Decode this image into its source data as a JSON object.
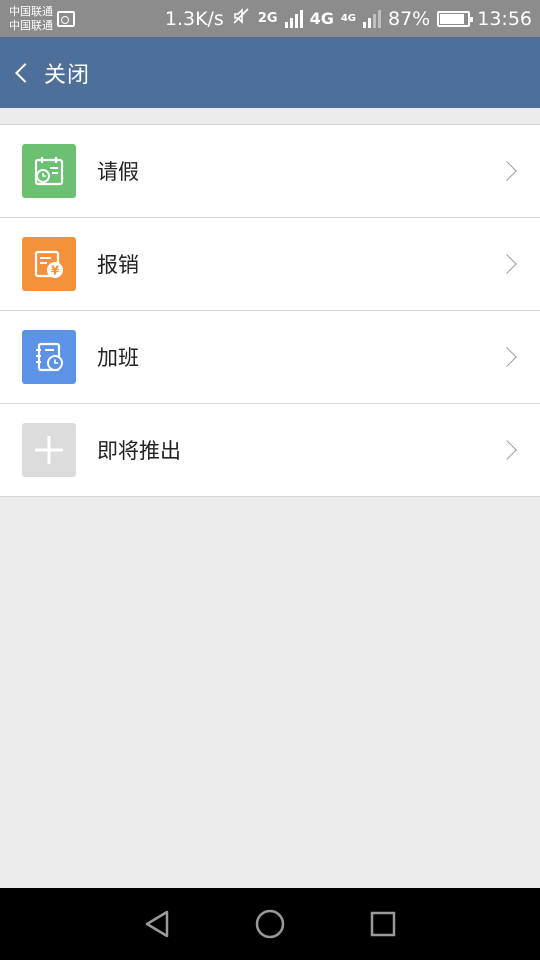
{
  "status_bar": {
    "carrier_1": "中国联通",
    "carrier_2": "中国联通",
    "net_speed": "1.3K/s",
    "net_2g": "2G",
    "net_4g": "4G",
    "net_4g_small": "4G",
    "battery": "87%",
    "battery_level": 0.87,
    "time": "13:56"
  },
  "header": {
    "title": "关闭"
  },
  "menu": {
    "items": [
      {
        "label": "请假",
        "icon": "calendar-clock-icon",
        "color": "#6cc071"
      },
      {
        "label": "报销",
        "icon": "receipt-yen-icon",
        "color": "#f5913a"
      },
      {
        "label": "加班",
        "icon": "notebook-clock-icon",
        "color": "#5b93e6"
      },
      {
        "label": "即将推出",
        "icon": "plus-icon",
        "color": "#dcdcdc"
      }
    ]
  },
  "colors": {
    "header_bg": "#4d6f9a",
    "page_bg": "#ececec"
  }
}
